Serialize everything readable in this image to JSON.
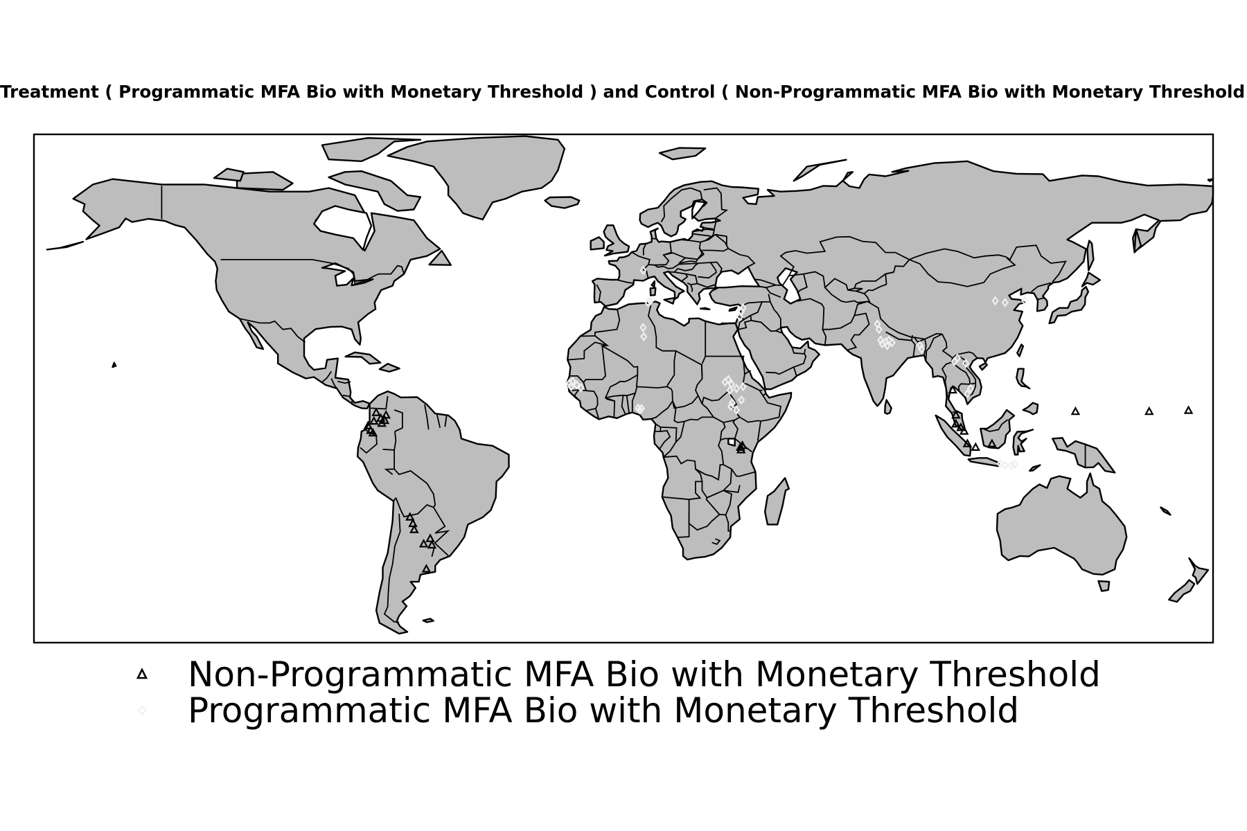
{
  "title": "Treatment ( Programmatic MFA Bio with Monetary Threshold ) and Control ( Non-Programmatic MFA Bio with Monetary Threshold ) Locations",
  "map": {
    "projection": "equirectangular",
    "land_color": "#bdbdbd",
    "border_color": "#000000",
    "ocean_color": "#ffffff"
  },
  "legend": {
    "items": [
      {
        "label": "Non-Programmatic MFA Bio with Monetary Threshold",
        "marker": "triangle",
        "color": "#000000"
      },
      {
        "label": "Programmatic MFA Bio with Monetary Threshold",
        "marker": "diamond",
        "color": "#f0f0f0"
      }
    ]
  },
  "chart_data": {
    "type": "scatter",
    "xlim": [
      -180,
      180
    ],
    "ylim": [
      -58,
      84
    ],
    "series": [
      {
        "name": "Non-Programmatic MFA Bio with Monetary Threshold",
        "marker": "triangle",
        "points": [
          [
            -78.0,
            2.5
          ],
          [
            -76.2,
            3.8
          ],
          [
            -75.5,
            6.2
          ],
          [
            -74.1,
            4.6
          ],
          [
            -73.8,
            3.2
          ],
          [
            -72.9,
            4.0
          ],
          [
            -77.2,
            1.2
          ],
          [
            -76.5,
            0.5
          ],
          [
            -72.5,
            5.5
          ],
          [
            -65.2,
            -23.0
          ],
          [
            -64.3,
            -24.8
          ],
          [
            -63.9,
            -26.5
          ],
          [
            -61.0,
            -30.5
          ],
          [
            -59.0,
            -29.0
          ],
          [
            -58.5,
            -30.8
          ],
          [
            -60.2,
            -37.5
          ],
          [
            35.7,
            -3.5
          ],
          [
            35.9,
            -4.2
          ],
          [
            36.3,
            -3.0
          ],
          [
            100.5,
            12.5
          ],
          [
            101.5,
            5.5
          ],
          [
            101.5,
            3.0
          ],
          [
            103.0,
            2.0
          ],
          [
            104.0,
            1.0
          ],
          [
            105.0,
            -2.5
          ],
          [
            107.5,
            -3.5
          ],
          [
            112.5,
            -2.5
          ],
          [
            138.0,
            6.5
          ],
          [
            160.5,
            6.5
          ],
          [
            172.5,
            6.8
          ]
        ]
      },
      {
        "name": "Programmatic MFA Bio with Monetary Threshold",
        "marker": "diamond",
        "points": [
          [
            6.0,
            46.0
          ],
          [
            7.5,
            37.0
          ],
          [
            8.2,
            37.4
          ],
          [
            6.0,
            30.0
          ],
          [
            6.2,
            27.5
          ],
          [
            -16.5,
            14.5
          ],
          [
            -15.5,
            15.0
          ],
          [
            -14.3,
            14.0
          ],
          [
            -13.0,
            13.2
          ],
          [
            -16.0,
            13.5
          ],
          [
            4.5,
            7.5
          ],
          [
            5.0,
            7.0
          ],
          [
            5.5,
            7.4
          ],
          [
            31.0,
            14.8
          ],
          [
            32.0,
            15.5
          ],
          [
            33.0,
            14.2
          ],
          [
            34.5,
            13.0
          ],
          [
            36.5,
            13.5
          ],
          [
            32.5,
            12.5
          ],
          [
            36.0,
            9.8
          ],
          [
            33.2,
            9.0
          ],
          [
            34.5,
            7.0
          ],
          [
            32.8,
            8.0
          ],
          [
            35.5,
            33.0
          ],
          [
            36.0,
            34.5
          ],
          [
            36.5,
            35.5
          ],
          [
            77.5,
            31.0
          ],
          [
            78.0,
            29.5
          ],
          [
            78.5,
            26.5
          ],
          [
            79.0,
            25.5
          ],
          [
            80.0,
            26.0
          ],
          [
            80.5,
            25.0
          ],
          [
            81.0,
            26.5
          ],
          [
            82.0,
            25.8
          ],
          [
            90.5,
            25.0
          ],
          [
            91.0,
            24.0
          ],
          [
            101.0,
            20.5
          ],
          [
            102.0,
            21.5
          ],
          [
            104.5,
            20.0
          ],
          [
            106.0,
            13.0
          ],
          [
            105.0,
            11.5
          ],
          [
            113.5,
            37.5
          ],
          [
            116.5,
            37.0
          ],
          [
            122.5,
            37.5
          ],
          [
            115.0,
            -8.0
          ],
          [
            116.5,
            -8.5
          ],
          [
            118.5,
            -8.5
          ],
          [
            119.5,
            -8.2
          ]
        ]
      }
    ]
  }
}
